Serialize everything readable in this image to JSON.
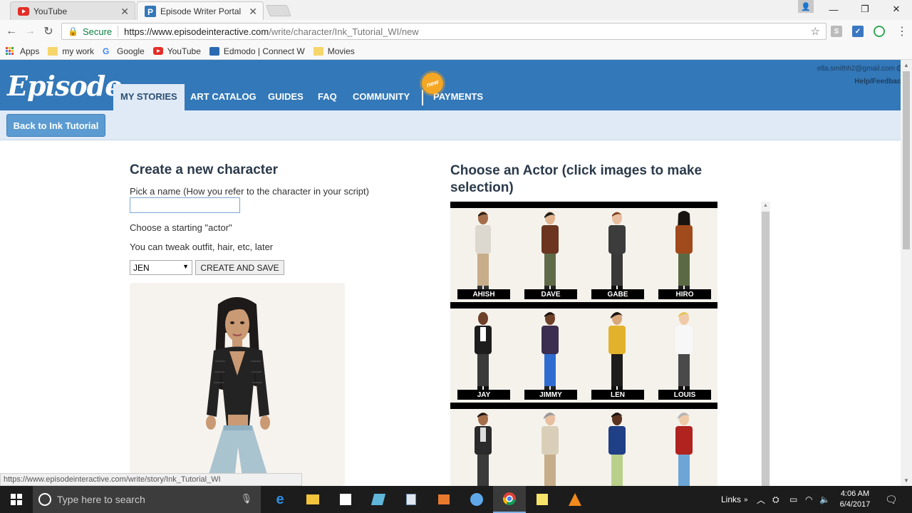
{
  "browser": {
    "tabs": [
      {
        "title": "YouTube",
        "active": false
      },
      {
        "title": "Episode Writer Portal",
        "active": true
      }
    ],
    "omnibox": {
      "secure_label": "Secure",
      "url_host": "https://www.episodeinteractive.com",
      "url_path": "/write/character/Ink_Tutorial_WI/new"
    },
    "bookmarks": [
      {
        "label": "Apps",
        "icon": "apps-grid-icon"
      },
      {
        "label": "my work",
        "icon": "folder-icon"
      },
      {
        "label": "Google",
        "icon": "google-icon"
      },
      {
        "label": "YouTube",
        "icon": "youtube-icon"
      },
      {
        "label": "Edmodo | Connect W",
        "icon": "edmodo-icon"
      },
      {
        "label": "Movies",
        "icon": "folder-icon"
      }
    ],
    "status_url": "https://www.episodeinteractive.com/write/story/Ink_Tutorial_WI"
  },
  "site": {
    "logo": "Episode",
    "nav": [
      "MY STORIES",
      "ART CATALOG",
      "GUIDES",
      "FAQ",
      "COMMUNITY",
      "PAYMENTS"
    ],
    "new_badge": "new",
    "account_email": "ella.smithh2@gmail.com",
    "help_link": "Help/Feedback",
    "back_button": "Back to Ink Tutorial",
    "brand_color": "#3378b8"
  },
  "form": {
    "title": "Create a new character",
    "name_prompt": "Pick a name (How you refer to the character in your script)",
    "name_value": "",
    "actor_prompt": "Choose a starting \"actor\"",
    "tweak_note": "You can tweak outfit, hair, etc, later",
    "selected_actor": "JEN",
    "create_button": "CREATE AND SAVE"
  },
  "actors": {
    "title": "Choose an Actor (click images to make selection)",
    "rows": [
      [
        "AHISH",
        "DAVE",
        "GABE",
        "HIRO"
      ],
      [
        "JAY",
        "JIMMY",
        "LEN",
        "LOUIS"
      ],
      [
        "",
        "",
        "",
        ""
      ]
    ]
  },
  "taskbar": {
    "search_placeholder": "Type here to search",
    "links_label": "Links",
    "time": "4:06 AM",
    "date": "6/4/2017"
  }
}
